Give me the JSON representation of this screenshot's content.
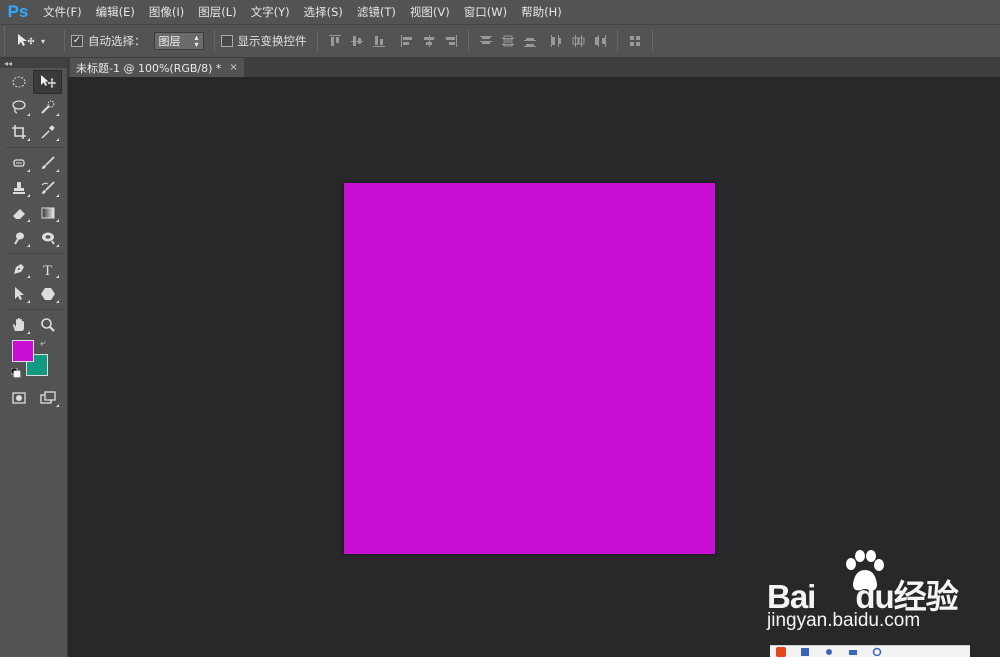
{
  "app": {
    "logo": "Ps"
  },
  "menu": [
    "文件(F)",
    "编辑(E)",
    "图像(I)",
    "图层(L)",
    "文字(Y)",
    "选择(S)",
    "滤镜(T)",
    "视图(V)",
    "窗口(W)",
    "帮助(H)"
  ],
  "options": {
    "auto_select_label": "自动选择：",
    "auto_select_checked": true,
    "auto_select_value": "图层",
    "show_transform_label": "显示变换控件",
    "show_transform_checked": false
  },
  "document": {
    "tab_title": "未标题-1 @ 100%(RGB/8) *",
    "close_glyph": "×"
  },
  "colors": {
    "foreground": "#c80ed4",
    "background": "#139a83",
    "canvas_fill": "#c80ed4",
    "workspace": "#28272a"
  },
  "watermark": {
    "logo_text_1": "Bai",
    "logo_text_2": "du",
    "logo_text_3": "经验",
    "url": "jingyan.baidu.com"
  }
}
